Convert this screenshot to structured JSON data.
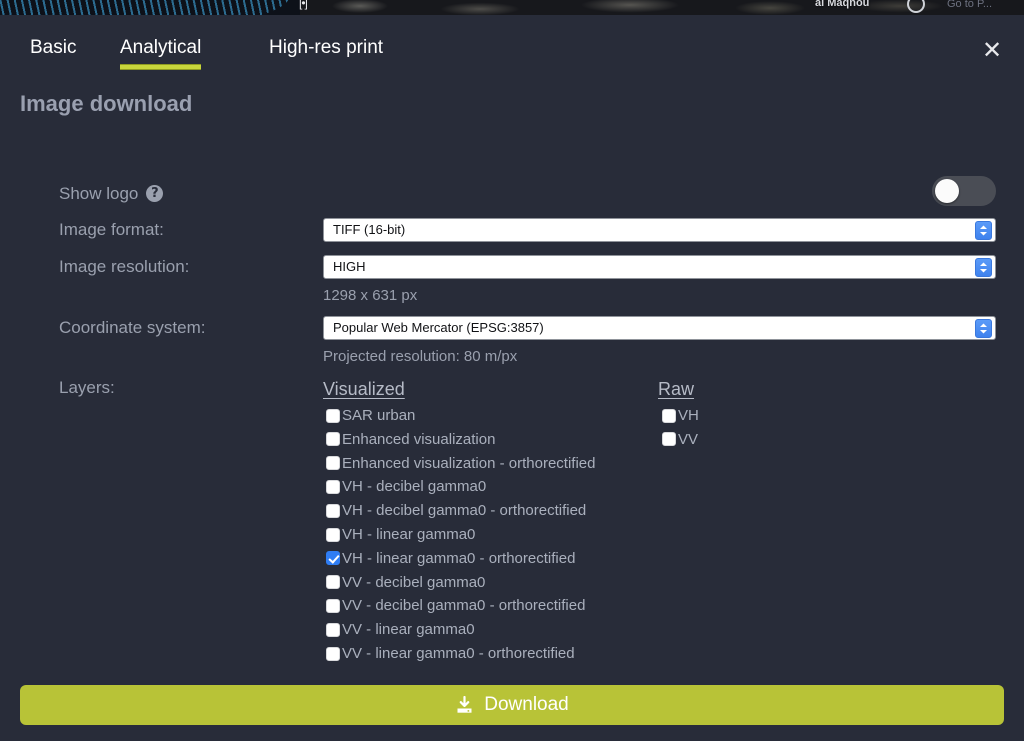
{
  "background_strip": {
    "place_label": "al Maqnou",
    "goto_label": "Go to P...",
    "poi_marker": "[•]"
  },
  "dialog": {
    "close_icon": "close-icon",
    "heading": "Image download",
    "tabs": [
      {
        "label": "Basic",
        "active": false
      },
      {
        "label": "Analytical",
        "active": true
      },
      {
        "label": "High-res print",
        "active": false
      }
    ],
    "accent_color": "#c8d63c",
    "panel_color": "#282c39"
  },
  "form": {
    "show_logo": {
      "label": "Show logo",
      "help_icon": "help-circle-icon",
      "toggle_state": "off"
    },
    "image_format": {
      "label": "Image format:",
      "value": "TIFF (16-bit)"
    },
    "image_resolution": {
      "label": "Image resolution:",
      "value": "HIGH",
      "note": "1298 x 631 px"
    },
    "coordinate_system": {
      "label": "Coordinate system:",
      "value": "Popular Web Mercator (EPSG:3857)",
      "note": "Projected resolution: 80 m/px"
    }
  },
  "layers": {
    "label": "Layers:",
    "visualized": {
      "title": "Visualized",
      "items": [
        {
          "label": "SAR urban",
          "checked": false
        },
        {
          "label": "Enhanced visualization",
          "checked": false
        },
        {
          "label": "Enhanced visualization - orthorectified",
          "checked": false
        },
        {
          "label": "VH - decibel gamma0",
          "checked": false
        },
        {
          "label": "VH - decibel gamma0 - orthorectified",
          "checked": false
        },
        {
          "label": "VH - linear gamma0",
          "checked": false
        },
        {
          "label": "VH - linear gamma0 - orthorectified",
          "checked": true
        },
        {
          "label": "VV - decibel gamma0",
          "checked": false
        },
        {
          "label": "VV - decibel gamma0 - orthorectified",
          "checked": false
        },
        {
          "label": "VV - linear gamma0",
          "checked": false
        },
        {
          "label": "VV - linear gamma0 - orthorectified",
          "checked": false
        }
      ]
    },
    "raw": {
      "title": "Raw",
      "items": [
        {
          "label": "VH",
          "checked": false
        },
        {
          "label": "VV",
          "checked": false
        }
      ]
    }
  },
  "download": {
    "label": "Download",
    "icon": "download-icon",
    "color": "#b8c337"
  }
}
